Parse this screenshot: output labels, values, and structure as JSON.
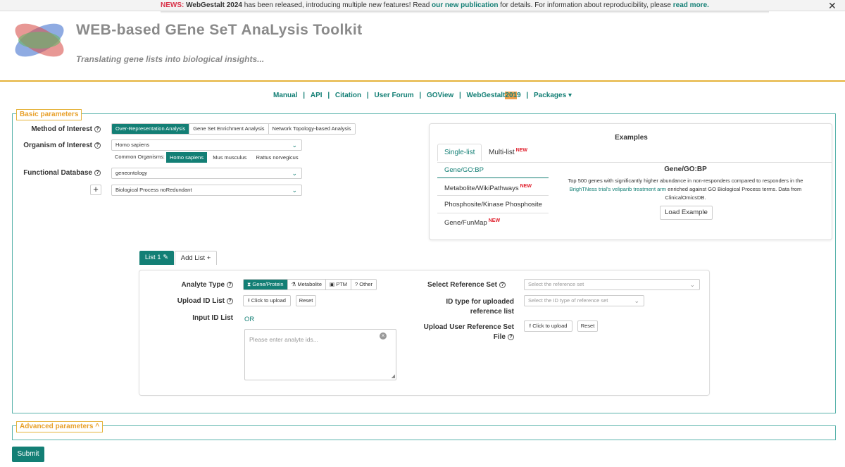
{
  "news": {
    "tag": "NEWS:",
    "strong": "WebGestalt 2024",
    "text1": " has been released, introducing multiple new features! Read ",
    "link1": "our new publication",
    "text2": " for details. For information about reproducibility, please ",
    "link2": "read more.",
    "close": "✕"
  },
  "header": {
    "title": "WEB-based GEne SeT AnaLysis Toolkit",
    "subtitle": "Translating gene lists into biological insights..."
  },
  "nav": {
    "manual": "Manual",
    "api": "API",
    "citation": "Citation",
    "forum": "User Forum",
    "goview": "GOView",
    "wg_prefix": "WebGestalt ",
    "wg_hl": "201",
    "wg_suffix": "9",
    "packages": "Packages ▾",
    "sep": "|"
  },
  "basic": {
    "legend": "Basic parameters",
    "method_label": "Method of Interest",
    "methods": [
      "Over-Representation Analysis",
      "Gene Set Enrichment Analysis",
      "Network Topology-based Analysis"
    ],
    "organism_label": "Organism of Interest",
    "organism_value": "Homo sapiens",
    "common_label": "Common Organisms:",
    "common": [
      "Homo sapiens",
      "Mus musculus",
      "Rattus norvegicus"
    ],
    "db_label": "Functional Database",
    "db_value": "geneontology",
    "db_sub_value": "Biological Process noRedundant",
    "plus": "+",
    "chevron": "⌄"
  },
  "examples": {
    "title": "Examples",
    "tabs": [
      "Single-list",
      "Multi-list"
    ],
    "new_badge": "NEW",
    "items": [
      "Gene/GO:BP",
      "Metabolite/WikiPathways",
      "Phosphosite/Kinase Phosphosite",
      "Gene/FunMap"
    ],
    "detail_title": "Gene/GO:BP",
    "desc1": "Top 500 genes with significantly higher abundance in non-responders compared to responders in the",
    "desc_link": "BrighTNess trial's veliparib treatment arm",
    "desc2": " enriched against GO Biological Process terms. Data from",
    "desc3": "ClinicalOmicsDB.",
    "load_button": "Load Example"
  },
  "lists": {
    "list1": "List 1",
    "add": "Add List",
    "analyte_label": "Analyte Type",
    "analyte_types": [
      "Gene/Protein",
      "Metabolite",
      "PTM",
      "Other"
    ],
    "upload_label": "Upload ID List",
    "click_upload": "Click to upload",
    "reset": "Reset",
    "input_label": "Input ID List",
    "or": "OR",
    "placeholder": "Please enter analyte ids...",
    "ref_label": "Select Reference Set",
    "ref_placeholder": "Select the reference set",
    "idtype_label_1": "ID type for uploaded",
    "idtype_label_2": "reference list",
    "idtype_placeholder": "Select the ID type of reference set",
    "user_ref_label_1": "Upload User Reference Set",
    "user_ref_label_2": "File"
  },
  "advanced": {
    "legend": "Advanced parameters ^"
  },
  "submit": "Submit",
  "colors": {
    "accent": "#137f75",
    "gold": "#e5b33b",
    "new": "#e0212e"
  }
}
